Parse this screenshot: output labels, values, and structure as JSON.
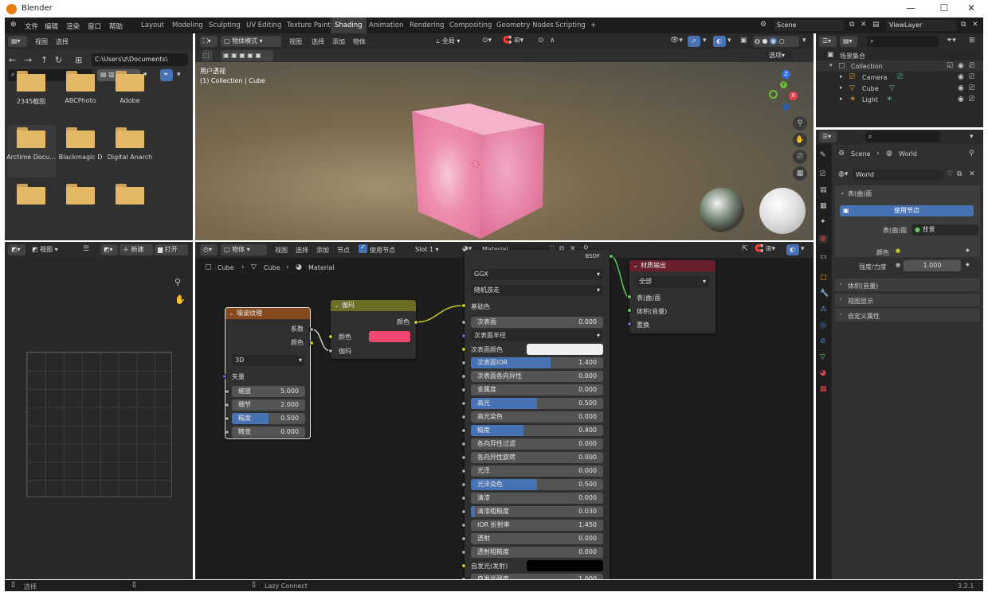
{
  "app": {
    "title": "Blender",
    "version": "3.2.1"
  },
  "menu": [
    "文件",
    "编辑",
    "渲染",
    "窗口",
    "帮助"
  ],
  "workspaces": [
    "Layout",
    "Modeling",
    "Sculpting",
    "UV Editing",
    "Texture Paint",
    "Shading",
    "Animation",
    "Rendering",
    "Compositing",
    "Geometry Nodes",
    "Scripting",
    "+"
  ],
  "topbar": {
    "scene": "Scene",
    "view_layer": "ViewLayer"
  },
  "file_browser": {
    "menu": [
      "视图",
      "选择"
    ],
    "path": "C:\\Users\\z\\Documents\\",
    "folders": [
      "2345截图",
      "ABCPhoto",
      "Adobe",
      "Arctime Docu...",
      "Blackmagic D",
      "Digital Anarch",
      "",
      "",
      ""
    ]
  },
  "image_editor": {
    "menu": [
      "视图"
    ],
    "new": "新建",
    "open": "打开"
  },
  "viewport": {
    "mode": "物体模式",
    "menu": [
      "视图",
      "选择",
      "添加",
      "物体"
    ],
    "transform": "全局",
    "select_label": "选项",
    "overlay_title": "用户透视",
    "overlay_sub": "(1) Collection | Cube",
    "gizmo": {
      "z": "Z",
      "y": "Y",
      "x": "X"
    }
  },
  "outliner": {
    "title": "场景集合",
    "items": [
      "Collection",
      "Camera",
      "Cube",
      "Light"
    ]
  },
  "node_editor": {
    "object_menu": "物体",
    "menu": [
      "视图",
      "选择",
      "添加",
      "节点"
    ],
    "use_nodes": "使用节点",
    "slot": "Slot 1",
    "material": "Material",
    "breadcrumb": [
      "Cube",
      "Cube",
      "Material"
    ]
  },
  "nodes": {
    "noise": {
      "title": "噪波纹理",
      "out_fac": "系数",
      "out_color": "颜色",
      "dim": "3D",
      "vector": "矢量",
      "fields": [
        {
          "label": "缩放",
          "value": "5.000",
          "fill": 0
        },
        {
          "label": "细节",
          "value": "2.000",
          "fill": 0
        },
        {
          "label": "糙度",
          "value": "0.500",
          "fill": 0.5
        },
        {
          "label": "畸变",
          "value": "0.000",
          "fill": 0
        }
      ]
    },
    "gamma": {
      "title": "伽玛",
      "out_color": "颜色",
      "in_color": "颜色",
      "in_gamma": "伽玛",
      "color_value": "#f0486e"
    },
    "bsdf": {
      "header_tail": "BSDF",
      "distribution": "GGX",
      "subsurface_method": "随机游走",
      "base_color": "基础色",
      "subsurface_radius": "次表面半径",
      "subsurface_color": "次表面颜色",
      "emission": "自发光(发射)",
      "fields": [
        {
          "label": "次表面",
          "value": "0.000",
          "fill": 0
        },
        {
          "label": "次表面IOR",
          "value": "1.400",
          "fill": 0.6
        },
        {
          "label": "次表面各向异性",
          "value": "0.000",
          "fill": 0
        },
        {
          "label": "金属度",
          "value": "0.000",
          "fill": 0
        },
        {
          "label": "高光",
          "value": "0.500",
          "fill": 0.5
        },
        {
          "label": "高光染色",
          "value": "0.000",
          "fill": 0
        },
        {
          "label": "糙度",
          "value": "0.400",
          "fill": 0.4
        },
        {
          "label": "各向异性过滤",
          "value": "0.000",
          "fill": 0
        },
        {
          "label": "各向异性旋转",
          "value": "0.000",
          "fill": 0
        },
        {
          "label": "光泽",
          "value": "0.000",
          "fill": 0
        },
        {
          "label": "光泽染色",
          "value": "0.500",
          "fill": 0.5
        },
        {
          "label": "清漆",
          "value": "0.000",
          "fill": 0
        },
        {
          "label": "清漆粗糙度",
          "value": "0.030",
          "fill": 0.03
        },
        {
          "label": "IOR 折射率",
          "value": "1.450",
          "fill": 0
        },
        {
          "label": "透射",
          "value": "0.000",
          "fill": 0
        },
        {
          "label": "透射粗糙度",
          "value": "0.000",
          "fill": 0
        }
      ],
      "emission_strength": "自发光强度",
      "emission_strength_value": "1.000"
    },
    "output": {
      "title": "材质输出",
      "target": "全部",
      "surface": "表(曲)面",
      "volume": "体积(音量)",
      "displacement": "置换"
    }
  },
  "properties": {
    "breadcrumb": [
      "Scene",
      "World"
    ],
    "world_name": "World",
    "surface_panel": "表(曲)面",
    "use_nodes": "使用节点",
    "surface_label": "表(曲)面",
    "surface_value": "背景",
    "color_label": "颜色",
    "strength_label": "强度/力度",
    "strength_value": "1.000",
    "panels": [
      "体积(音量)",
      "视图显示",
      "自定义属性"
    ]
  },
  "status": {
    "left": "选择",
    "mid": "Lazy Connect",
    "version": "3.2.1"
  }
}
